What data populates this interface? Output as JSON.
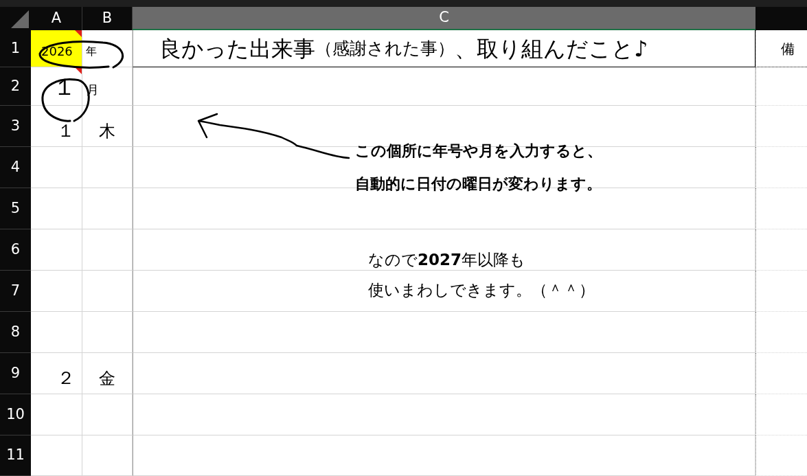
{
  "columns": [
    {
      "label": "A",
      "selected": false
    },
    {
      "label": "B",
      "selected": false
    },
    {
      "label": "C",
      "selected": true
    }
  ],
  "row_numbers": [
    "1",
    "2",
    "3",
    "4",
    "5",
    "6",
    "7",
    "8",
    "9",
    "10",
    "11"
  ],
  "year": {
    "value": "2026",
    "unit": "年",
    "highlighted": true,
    "has_comment": true
  },
  "month": {
    "value": "１",
    "unit": "月",
    "has_comment": true
  },
  "days": [
    {
      "day": "１",
      "weekday": "木"
    },
    {
      "day": "２",
      "weekday": "金"
    }
  ],
  "title": {
    "parts": [
      {
        "text": "良かった出来事",
        "kind": "large"
      },
      {
        "text": "（感謝された事）",
        "kind": "small"
      },
      {
        "text": "、取り組んだこと♪",
        "kind": "large"
      }
    ]
  },
  "notes_header": "備",
  "annotations": [
    {
      "lines": [
        "この個所に年号や月を入力すると、",
        "自動的に日付の曜日が変わります。"
      ]
    },
    {
      "lines": [
        "なので**2027**年以降も",
        "使いまわしできます。（＾＾）"
      ]
    }
  ]
}
